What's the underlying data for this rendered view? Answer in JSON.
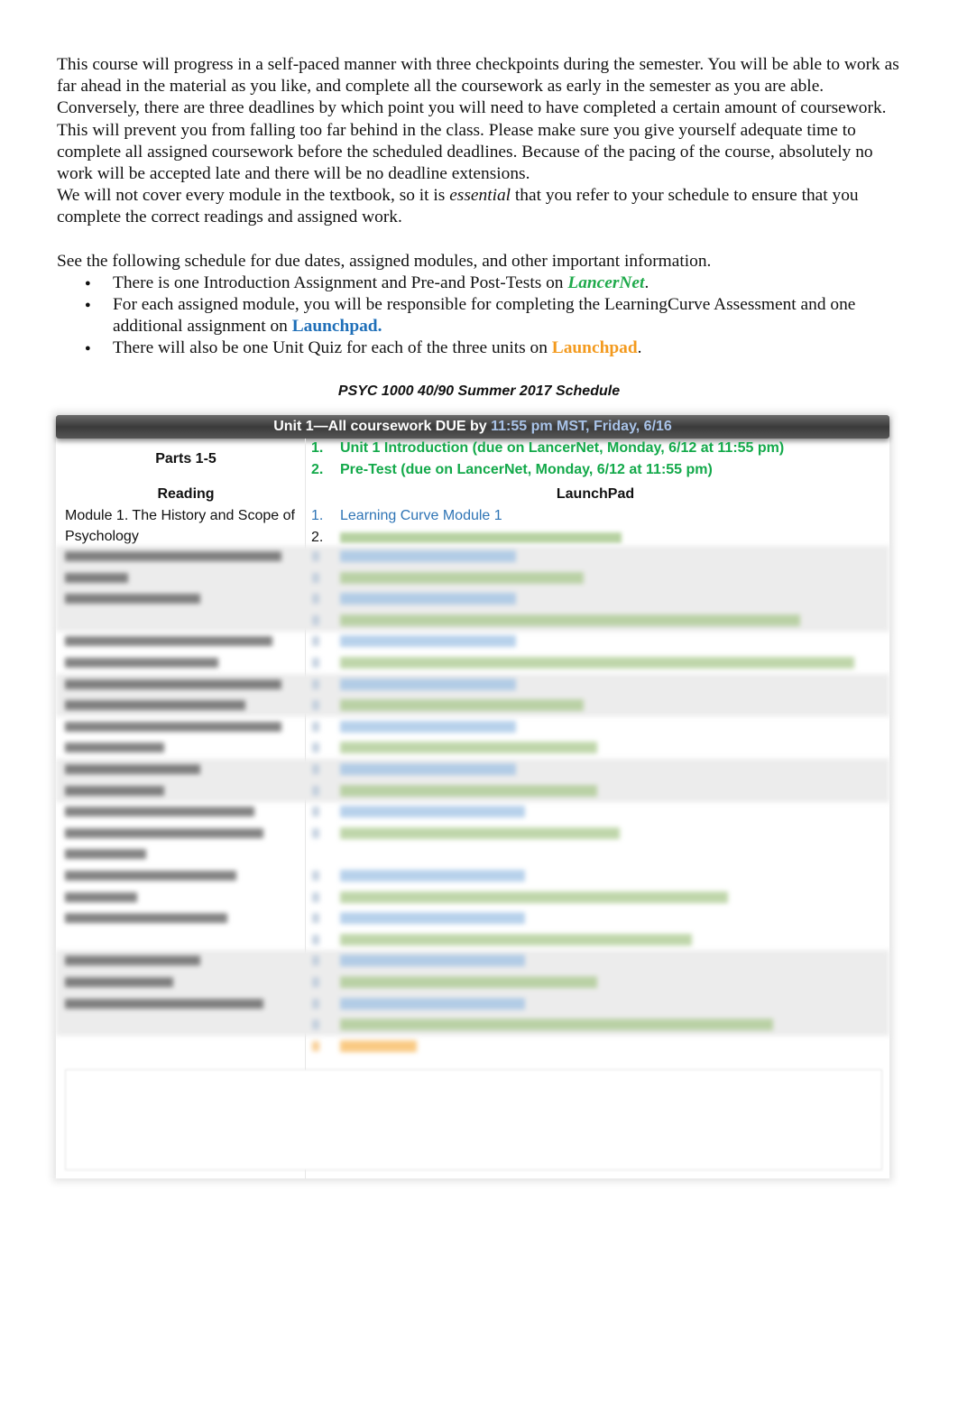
{
  "intro": {
    "paragraph1": "This course will progress in a self-paced manner with three checkpoints during the semester. You will be able to work as far ahead in the material as you like, and complete all the coursework as early in the semester as you are able. Conversely, there are three deadlines by which point you will need to have completed a certain amount of coursework. This will prevent you from falling too far behind in the class. Please make sure you give yourself adequate time to complete all assigned coursework before the scheduled deadlines. Because of the pacing of the course, absolutely no work will be accepted late and there will be no deadline extensions.",
    "paragraph2_before": "We will not cover every module in the textbook, so it is ",
    "paragraph2_emphasis": "essential",
    "paragraph2_after": " that you refer to your schedule to ensure that you complete the correct readings and assigned work.",
    "paragraph3": "See the following schedule for due dates, assigned modules, and other important information.",
    "bullets": [
      {
        "text": "There is one Introduction Assignment and Pre-and Post-Tests on ",
        "highlight": "LancerNet",
        "suffix": "."
      },
      {
        "text": "For each assigned module, you will be responsible for completing the LearningCurve Assessment and one additional assignment on ",
        "highlight": "Launchpad.",
        "suffix": ""
      },
      {
        "text": "There will also be one Unit Quiz for each of the three units on ",
        "highlight": "Launchpad",
        "suffix": "."
      }
    ]
  },
  "schedule": {
    "title": "PSYC 1000 40/90 Summer 2017 Schedule",
    "unit_header": {
      "label": "Unit 1—All coursework DUE by ",
      "due": "11:55 pm MST, Friday, 6/16"
    },
    "parts_label": "Parts 1-5",
    "parts_items": [
      {
        "num": "1.",
        "text": "Unit 1 Introduction (due on LancerNet, Monday, 6/12 at 11:55 pm)"
      },
      {
        "num": "2.",
        "text": "Pre-Test (due on LancerNet, Monday, 6/12 at 11:55 pm)"
      }
    ],
    "col_reading": "Reading",
    "col_launchpad": "LaunchPad",
    "first_module": {
      "reading": "Module 1. The History and Scope of Psychology",
      "items": [
        {
          "num": "1.",
          "text": "Learning Curve Module 1"
        },
        {
          "num": "2.",
          "text": ""
        }
      ]
    },
    "colors": {
      "green": "#13a94a",
      "blue": "#2e74b5",
      "orange": "#f39a1e",
      "header_due": "#a9c3e8"
    }
  }
}
